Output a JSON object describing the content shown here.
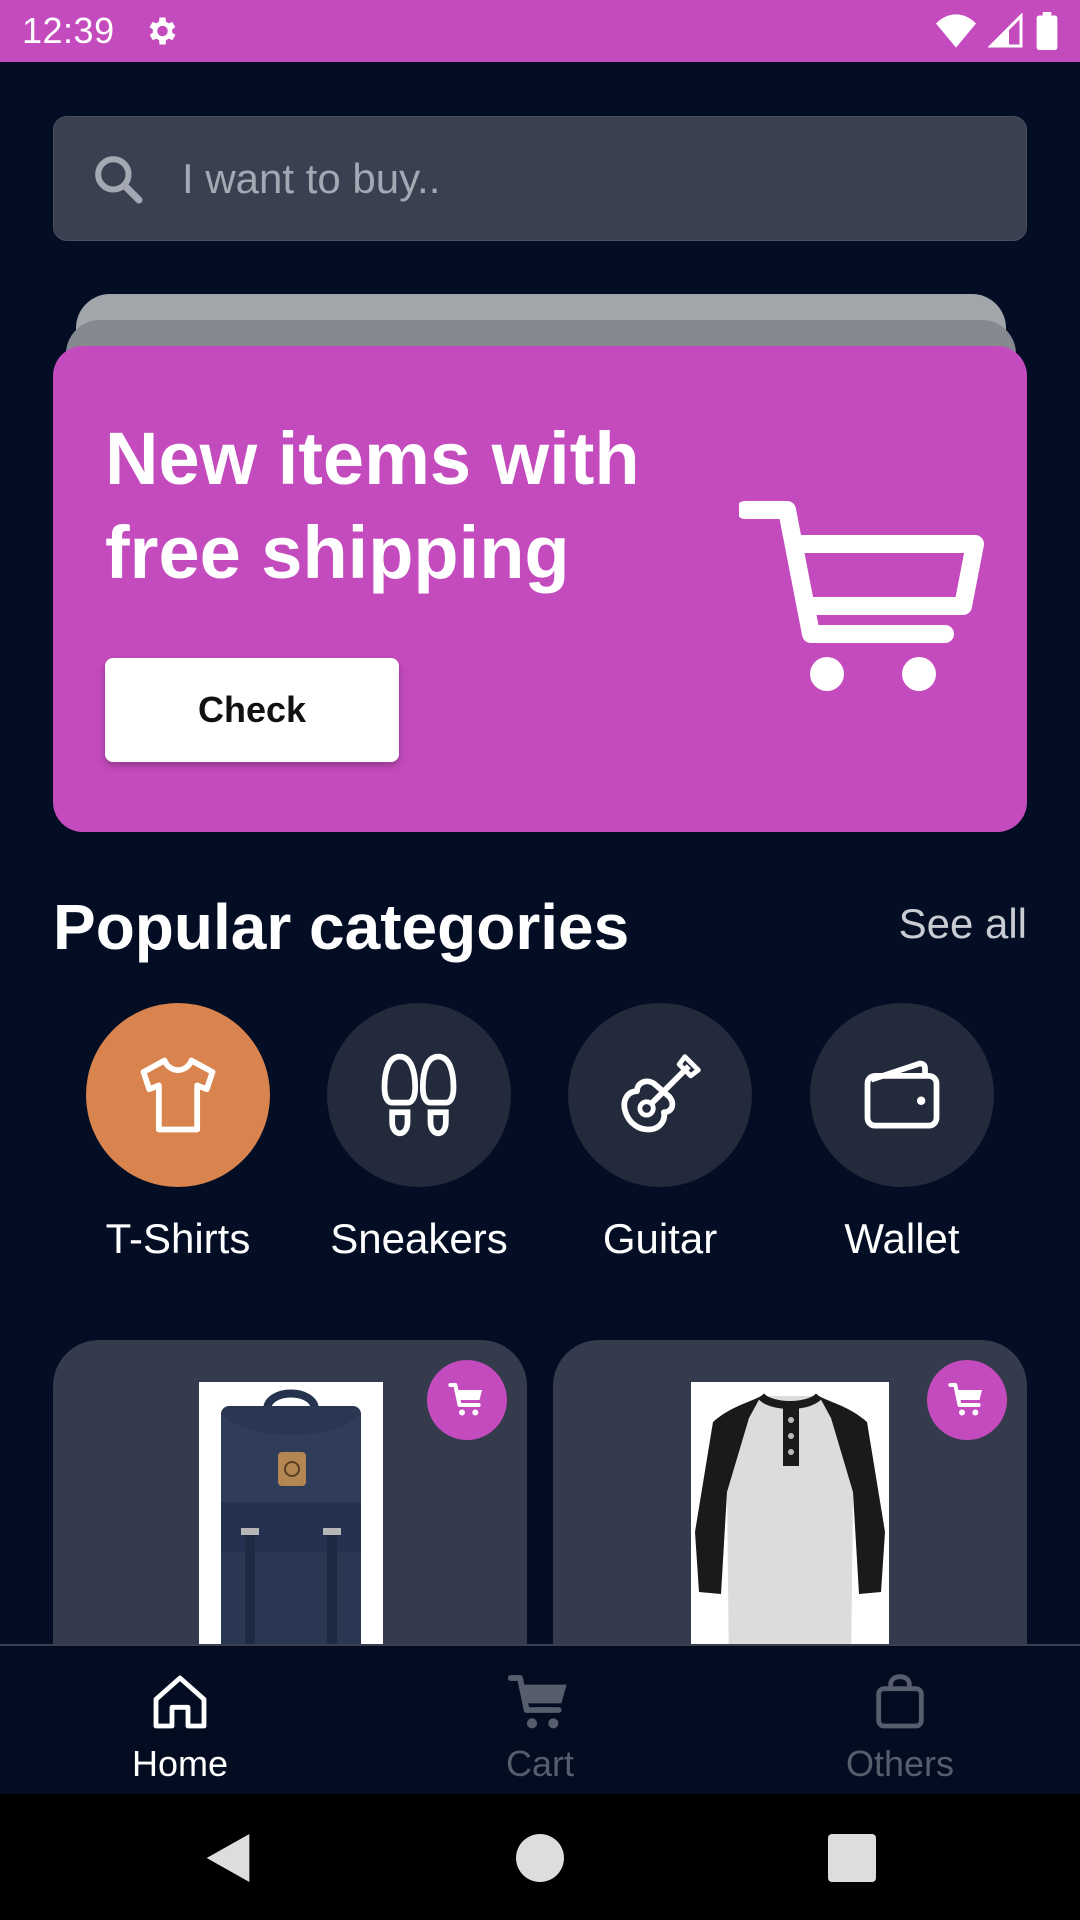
{
  "status_bar": {
    "time": "12:39",
    "icons": [
      "gear-icon",
      "wifi-icon",
      "signal-icon",
      "battery-icon"
    ]
  },
  "search": {
    "placeholder": "I want to buy..",
    "value": "",
    "icon": "search-icon"
  },
  "banner": {
    "title_line1": "New items with",
    "title_line2": "free shipping",
    "button_label": "Check",
    "icon": "cart-icon",
    "color": "#c44bbd"
  },
  "categories_section": {
    "title": "Popular categories",
    "see_all_label": "See all",
    "items": [
      {
        "label": "T-Shirts",
        "icon": "tshirt-icon",
        "active": true
      },
      {
        "label": "Sneakers",
        "icon": "footprints-icon",
        "active": false
      },
      {
        "label": "Guitar",
        "icon": "guitar-icon",
        "active": false
      },
      {
        "label": "Wallet",
        "icon": "wallet-icon",
        "active": false
      }
    ]
  },
  "products": [
    {
      "image": "backpack",
      "action_icon": "add-to-cart-icon"
    },
    {
      "image": "raglan-shirt",
      "action_icon": "add-to-cart-icon"
    }
  ],
  "bottom_nav": {
    "items": [
      {
        "label": "Home",
        "icon": "home-icon",
        "active": true
      },
      {
        "label": "Cart",
        "icon": "cart-icon",
        "active": false
      },
      {
        "label": "Others",
        "icon": "bag-icon",
        "active": false
      }
    ]
  },
  "colors": {
    "accent": "#c44bbd",
    "active_category": "#d9844f",
    "background": "#030e24",
    "surface": "#343b4c"
  }
}
